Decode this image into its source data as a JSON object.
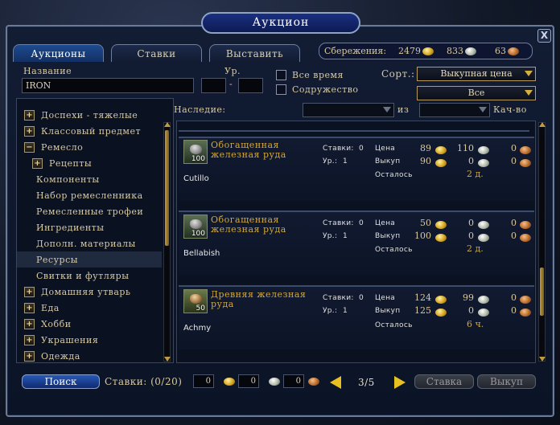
{
  "window": {
    "title": "Аукцион",
    "close_label": "X"
  },
  "tabs": [
    {
      "label": "Аукционы"
    },
    {
      "label": "Ставки"
    },
    {
      "label": "Выставить"
    }
  ],
  "savings": {
    "label": "Сбережения:",
    "gold": "2479",
    "silver": "833",
    "copper": "63"
  },
  "search": {
    "name_label": "Название",
    "name_value": "IRON",
    "level_label": "Ур.",
    "level_dash": "-",
    "level_from": "",
    "level_to": "",
    "all_time_label": "Все время",
    "fellowship_label": "Содружество",
    "sort_label": "Сорт.:",
    "sort_value": "Выкупная цена",
    "sort2_value": "Все",
    "legacy_label": "Наследие:",
    "from_label": "из",
    "quality_label": "Кач-во"
  },
  "categories": [
    {
      "label": "Доспехи - тяжелые",
      "expander": "+"
    },
    {
      "label": "Классовый предмет",
      "expander": "+"
    },
    {
      "label": "Ремесло",
      "expander": "−"
    },
    {
      "label": "Рецепты",
      "expander": "+"
    },
    {
      "label": "Компоненты"
    },
    {
      "label": "Набор ремесленника"
    },
    {
      "label": "Ремесленные трофеи"
    },
    {
      "label": "Ингредиенты"
    },
    {
      "label": "Дополн. материалы"
    },
    {
      "label": "Ресурсы"
    },
    {
      "label": "Свитки и футляры"
    },
    {
      "label": "Домашняя утварь",
      "expander": "+"
    },
    {
      "label": "Еда",
      "expander": "+"
    },
    {
      "label": "Хобби",
      "expander": "+"
    },
    {
      "label": "Украшения",
      "expander": "+"
    },
    {
      "label": "Одежда",
      "expander": "+"
    }
  ],
  "listing_labels": {
    "bids": "Ставки:",
    "level": "Ур.:",
    "price": "Цена",
    "buyout": "Выкуп",
    "remaining": "Осталось"
  },
  "listings": [
    {
      "name_line1": "Обогащенная",
      "name_line2": "железная руда",
      "quantity": "100",
      "seller": "Cutillo",
      "bids": "0",
      "level": "1",
      "price": {
        "gold": "89",
        "silver": "110",
        "copper": "0"
      },
      "buyout": {
        "gold": "90",
        "silver": "0",
        "copper": "0"
      },
      "remaining": "2 д."
    },
    {
      "name_line1": "Обогащенная",
      "name_line2": "железная руда",
      "quantity": "100",
      "seller": "Bellabish",
      "bids": "0",
      "level": "1",
      "price": {
        "gold": "50",
        "silver": "0",
        "copper": "0"
      },
      "buyout": {
        "gold": "100",
        "silver": "0",
        "copper": "0"
      },
      "remaining": "2 д."
    },
    {
      "name_line1": "Древняя железная",
      "name_line2": "руда",
      "quantity": "50",
      "seller": "Achmy",
      "bids": "0",
      "level": "1",
      "price": {
        "gold": "124",
        "silver": "99",
        "copper": "0"
      },
      "buyout": {
        "gold": "125",
        "silver": "0",
        "copper": "0"
      },
      "remaining": "6 ч."
    }
  ],
  "bottom": {
    "search_button": "Поиск",
    "bids_label": "Ставки: (0/20)",
    "bid_gold": "0",
    "bid_silver": "0",
    "bid_copper": "0",
    "page": "3/5",
    "bid_button": "Ставка",
    "buyout_button": "Выкуп"
  }
}
